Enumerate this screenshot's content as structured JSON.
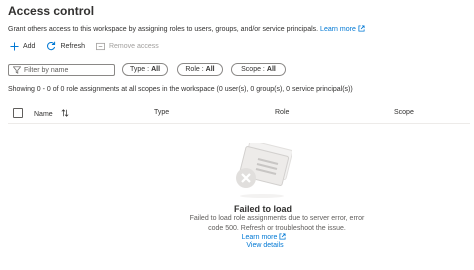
{
  "page": {
    "title": "Access control",
    "description": "Grant others access to this workspace by assigning roles to users, groups, and/or service principals.",
    "learn_more": "Learn more"
  },
  "toolbar": {
    "add_label": "Add",
    "refresh_label": "Refresh",
    "remove_label": "Remove access"
  },
  "filters": {
    "search_placeholder": "Filter by name",
    "type": {
      "label": "Type :",
      "value": "All"
    },
    "role": {
      "label": "Role :",
      "value": "All"
    },
    "scope": {
      "label": "Scope :",
      "value": "All"
    }
  },
  "summary": "Showing 0 - 0 of 0 role assignments at all scopes in the workspace (0 user(s), 0 group(s), 0 service principal(s))",
  "table": {
    "columns": [
      "Name",
      "Type",
      "Role",
      "Scope"
    ]
  },
  "empty_state": {
    "title": "Failed to load",
    "message": "Failed to load role assignments due to server error, error code 500. Refresh or troubleshoot the issue.",
    "learn_more": "Learn more",
    "view_details": "View details"
  },
  "colors": {
    "accent": "#0078d4",
    "text": "#323130",
    "muted": "#605e5c",
    "disabled": "#a19f9d",
    "border": "#8a8886"
  }
}
